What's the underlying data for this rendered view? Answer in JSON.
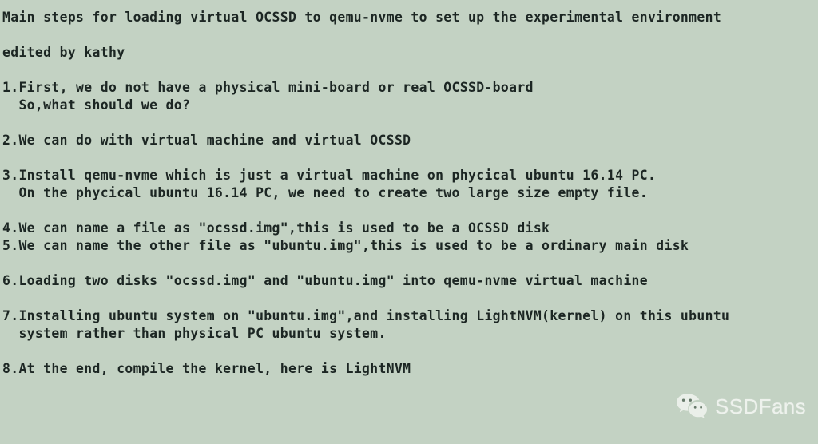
{
  "document": {
    "background_color": "#c3d2c3",
    "text_color": "#1c2623",
    "title": "Main steps for loading virtual OCSSD to qemu-nvme to set up the experimental environment",
    "byline": "edited by kathy",
    "lines": [
      {
        "id": "title",
        "text": "Main steps for loading virtual OCSSD to qemu-nvme to set up the experimental environment"
      },
      {
        "id": "gap1",
        "text": " "
      },
      {
        "id": "byline",
        "text": "edited by kathy"
      },
      {
        "id": "gap2",
        "text": " "
      },
      {
        "id": "item1a",
        "text": "1.First, we do not have a physical mini-board or real OCSSD-board"
      },
      {
        "id": "item1b",
        "text": "  So,what should we do?"
      },
      {
        "id": "gap3",
        "text": " "
      },
      {
        "id": "item2",
        "text": "2.We can do with virtual machine and virtual OCSSD"
      },
      {
        "id": "gap4",
        "text": " "
      },
      {
        "id": "item3a",
        "text": "3.Install qemu-nvme which is just a virtual machine on phycical ubuntu 16.14 PC."
      },
      {
        "id": "item3b",
        "text": "  On the phycical ubuntu 16.14 PC, we need to create two large size empty file."
      },
      {
        "id": "gap5",
        "text": " "
      },
      {
        "id": "item4",
        "text": "4.We can name a file as \"ocssd.img\",this is used to be a OCSSD disk"
      },
      {
        "id": "item5",
        "text": "5.We can name the other file as \"ubuntu.img\",this is used to be a ordinary main disk"
      },
      {
        "id": "gap6",
        "text": " "
      },
      {
        "id": "item6",
        "text": "6.Loading two disks \"ocssd.img\" and \"ubuntu.img\" into qemu-nvme virtual machine"
      },
      {
        "id": "gap7",
        "text": " "
      },
      {
        "id": "item7a",
        "text": "7.Installing ubuntu system on \"ubuntu.img\",and installing LightNVM(kernel) on this ubuntu"
      },
      {
        "id": "item7b",
        "text": "  system rather than physical PC ubuntu system."
      },
      {
        "id": "gap8",
        "text": " "
      },
      {
        "id": "item8",
        "text": "8.At the end, compile the kernel, here is LightNVM"
      }
    ],
    "numbered_steps": [
      {
        "number": "1",
        "text": "First, we do not have a physical mini-board or real OCSSD-board So,what should we do?"
      },
      {
        "number": "2",
        "text": "We can do with virtual machine and virtual OCSSD"
      },
      {
        "number": "3",
        "text": "Install qemu-nvme which is just a virtual machine on phycical ubuntu 16.14 PC. On the phycical ubuntu 16.14 PC, we need to create two large size empty file."
      },
      {
        "number": "4",
        "text": "We can name a file as \"ocssd.img\",this is used to be a OCSSD disk"
      },
      {
        "number": "5",
        "text": "We can name the other file as \"ubuntu.img\",this is used to be a ordinary main disk"
      },
      {
        "number": "6",
        "text": "Loading two disks \"ocssd.img\" and \"ubuntu.img\" into qemu-nvme virtual machine"
      },
      {
        "number": "7",
        "text": "Installing ubuntu system on \"ubuntu.img\",and installing LightNVM(kernel) on this ubuntu system rather than physical PC ubuntu system."
      },
      {
        "number": "8",
        "text": "At the end, compile the kernel, here is LightNVM"
      }
    ]
  },
  "watermark": {
    "brand": "SSDFans",
    "icon": "wechat-icon",
    "text_color": "#f2f5f1"
  }
}
